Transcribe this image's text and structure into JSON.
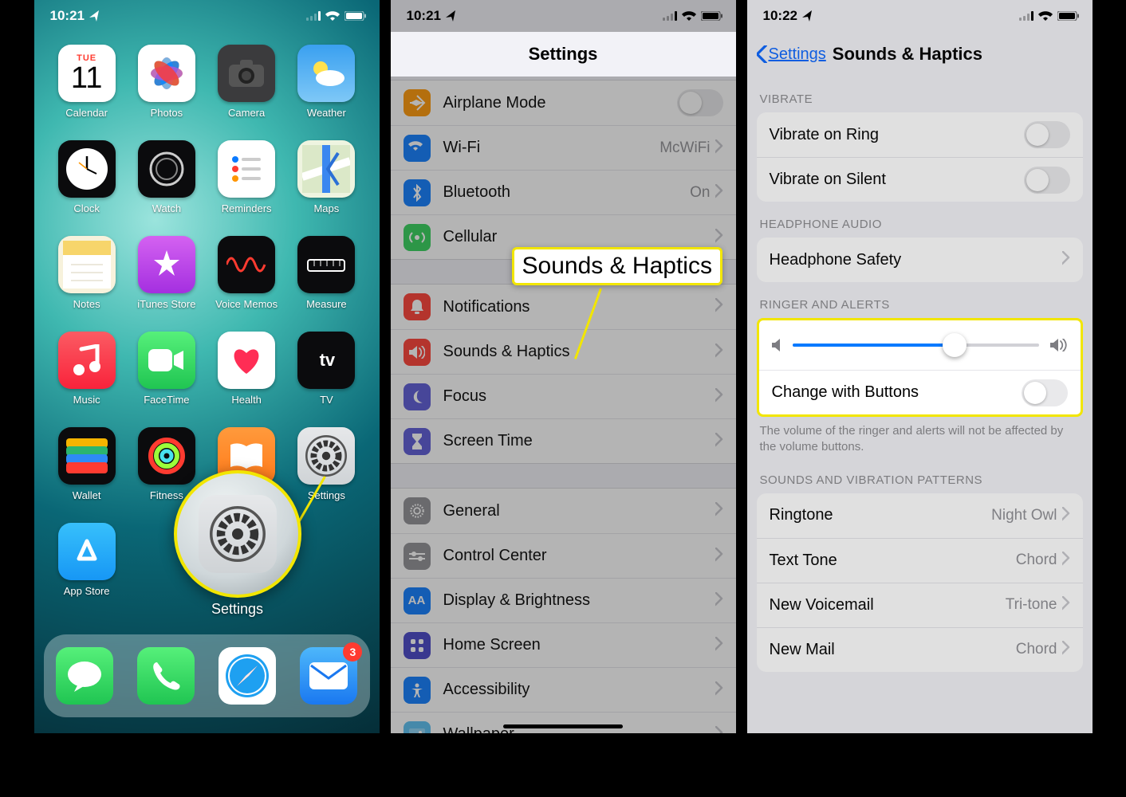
{
  "panel1": {
    "time": "10:21",
    "apps": [
      {
        "label": "Calendar",
        "day": "11",
        "dow": "TUE",
        "bg": "#ffffff"
      },
      {
        "label": "Photos",
        "bg": "#ffffff"
      },
      {
        "label": "Camera",
        "bg": "#3b3b3d"
      },
      {
        "label": "Weather",
        "bg": "linear-gradient(#3aa0f0,#7ec8f7)"
      },
      {
        "label": "Clock",
        "bg": "#0b0b0d"
      },
      {
        "label": "Watch",
        "bg": "#0b0b0d"
      },
      {
        "label": "Reminders",
        "bg": "#ffffff"
      },
      {
        "label": "Maps",
        "bg": "#eef4e0"
      },
      {
        "label": "Notes",
        "bg": "#f7f2dc"
      },
      {
        "label": "iTunes Store",
        "bg": "linear-gradient(#d462f1,#a42fe0)"
      },
      {
        "label": "Voice Memos",
        "bg": "#0b0b0d"
      },
      {
        "label": "Measure",
        "bg": "#0b0b0d"
      },
      {
        "label": "Music",
        "bg": "linear-gradient(#fb5b63,#f9233b)"
      },
      {
        "label": "FaceTime",
        "bg": "linear-gradient(#56f07a,#20c552)"
      },
      {
        "label": "Health",
        "bg": "#ffffff"
      },
      {
        "label": "TV",
        "bg": "#0b0b0d"
      },
      {
        "label": "Wallet",
        "bg": "#0b0b0d"
      },
      {
        "label": "Fitness",
        "bg": "#0b0b0d"
      },
      {
        "label": "Books",
        "bg": "linear-gradient(#ff9a3c,#ff7a1a)"
      },
      {
        "label": "Settings",
        "bg": "linear-gradient(#e6e8ea,#cfd3d6)"
      },
      {
        "label": "App Store",
        "bg": "linear-gradient(#37c0fb,#1797f5)"
      }
    ],
    "dock": [
      {
        "name": "messages",
        "bg": "linear-gradient(#56f07a,#20c552)"
      },
      {
        "name": "phone",
        "bg": "linear-gradient(#56f07a,#20c552)"
      },
      {
        "name": "safari",
        "bg": "#ffffff"
      },
      {
        "name": "mail",
        "bg": "linear-gradient(#4db7fb,#1a78f0)",
        "badge": "3"
      }
    ],
    "zoom_label": "Settings"
  },
  "panel2": {
    "time": "10:21",
    "title": "Settings",
    "g1": [
      {
        "icon": "airplane",
        "bg": "#ff9500",
        "label": "Airplane Mode",
        "toggle": true
      },
      {
        "icon": "wifi",
        "bg": "#0a7aff",
        "label": "Wi-Fi",
        "value": "McWiFi",
        "chev": true
      },
      {
        "icon": "bt",
        "bg": "#0a7aff",
        "label": "Bluetooth",
        "value": "On",
        "chev": true
      },
      {
        "icon": "cell",
        "bg": "#30d158",
        "label": "Cellular",
        "chev": true
      }
    ],
    "g2": [
      {
        "icon": "bell",
        "bg": "#ff3b30",
        "label": "Notifications",
        "chev": true
      },
      {
        "icon": "sound",
        "bg": "#ff3b30",
        "label": "Sounds & Haptics",
        "chev": true
      },
      {
        "icon": "moon",
        "bg": "#5856d6",
        "label": "Focus",
        "chev": true
      },
      {
        "icon": "timer",
        "bg": "#5856d6",
        "label": "Screen Time",
        "chev": true
      }
    ],
    "g3": [
      {
        "icon": "gear",
        "bg": "#8e8e93",
        "label": "General",
        "chev": true
      },
      {
        "icon": "cc",
        "bg": "#8e8e93",
        "label": "Control Center",
        "chev": true
      },
      {
        "icon": "aa",
        "bg": "#0a7aff",
        "label": "Display & Brightness",
        "chev": true
      },
      {
        "icon": "grid",
        "bg": "#4341c6",
        "label": "Home Screen",
        "chev": true
      },
      {
        "icon": "acc",
        "bg": "#0a7aff",
        "label": "Accessibility",
        "chev": true
      },
      {
        "icon": "wall",
        "bg": "#55bef0",
        "label": "Wallpaper",
        "chev": true
      }
    ],
    "callout": "Sounds & Haptics"
  },
  "panel3": {
    "time": "10:22",
    "back": "Settings",
    "title": "Sounds & Haptics",
    "sec_vibrate": "VIBRATE",
    "vibrate": [
      {
        "label": "Vibrate on Ring"
      },
      {
        "label": "Vibrate on Silent"
      }
    ],
    "sec_headphone": "HEADPHONE AUDIO",
    "headphone_row": "Headphone Safety",
    "sec_ringer": "RINGER AND ALERTS",
    "change_buttons": "Change with Buttons",
    "ringer_footer": "The volume of the ringer and alerts will not be affected by the volume buttons.",
    "sec_patterns": "SOUNDS AND VIBRATION PATTERNS",
    "patterns": [
      {
        "label": "Ringtone",
        "value": "Night Owl"
      },
      {
        "label": "Text Tone",
        "value": "Chord"
      },
      {
        "label": "New Voicemail",
        "value": "Tri-tone"
      },
      {
        "label": "New Mail",
        "value": "Chord"
      }
    ]
  }
}
